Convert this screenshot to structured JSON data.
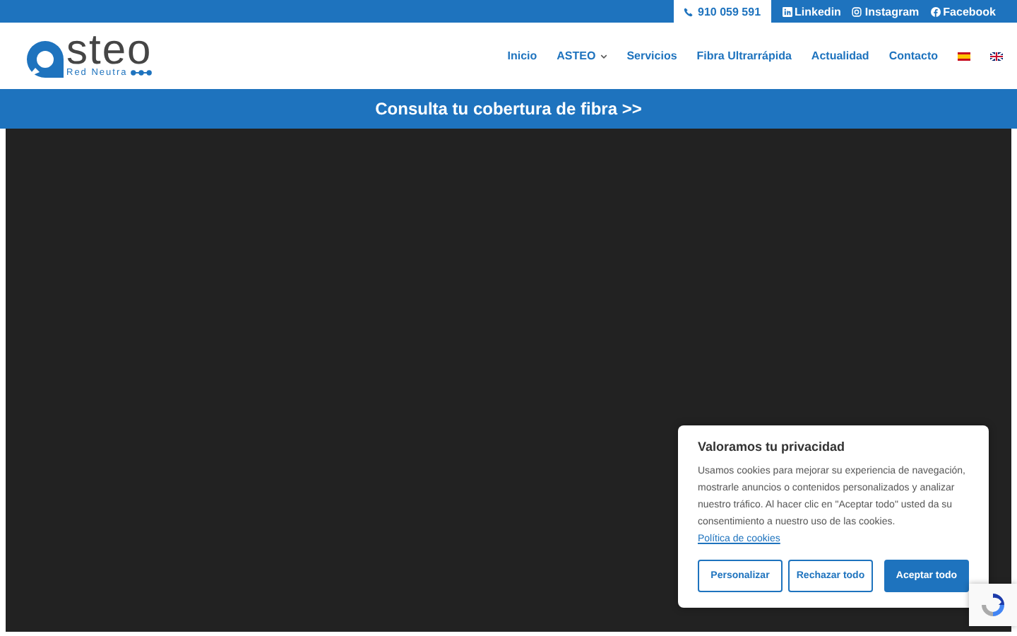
{
  "top_bar": {
    "phone": "910 059 591",
    "links": [
      {
        "kind": "linkedin",
        "label": "Linkedin"
      },
      {
        "kind": "instagram",
        "label": "Instagram"
      },
      {
        "kind": "facebook",
        "label": "Facebook"
      }
    ]
  },
  "logo": {
    "text": "steo",
    "tagline": "Red Neutra"
  },
  "nav": {
    "items": [
      {
        "label": "Inicio",
        "dropdown": false
      },
      {
        "label": "ASTEO",
        "dropdown": true
      },
      {
        "label": "Servicios",
        "dropdown": false
      },
      {
        "label": "Fibra Ultrarrápida",
        "dropdown": false
      },
      {
        "label": "Actualidad",
        "dropdown": false
      },
      {
        "label": "Contacto",
        "dropdown": false
      }
    ],
    "languages": [
      {
        "kind": "es"
      },
      {
        "kind": "en"
      }
    ]
  },
  "banner": {
    "text": "Consulta tu cobertura de fibra >>"
  },
  "cookie_dialog": {
    "title": "Valoramos tu privacidad",
    "body": "Usamos cookies para mejorar su experiencia de navegación, mostrarle anuncios o contenidos personalizados y analizar nuestro tráfico. Al hacer clic en \"Aceptar todo\" usted da su consentimiento a nuestro uso de las cookies.",
    "link": "Política de cookies",
    "buttons": [
      {
        "label": "Personalizar",
        "kind": "outline"
      },
      {
        "label": "Rechazar todo",
        "kind": "outline"
      },
      {
        "label": "Aceptar todo",
        "kind": "primary"
      }
    ]
  }
}
